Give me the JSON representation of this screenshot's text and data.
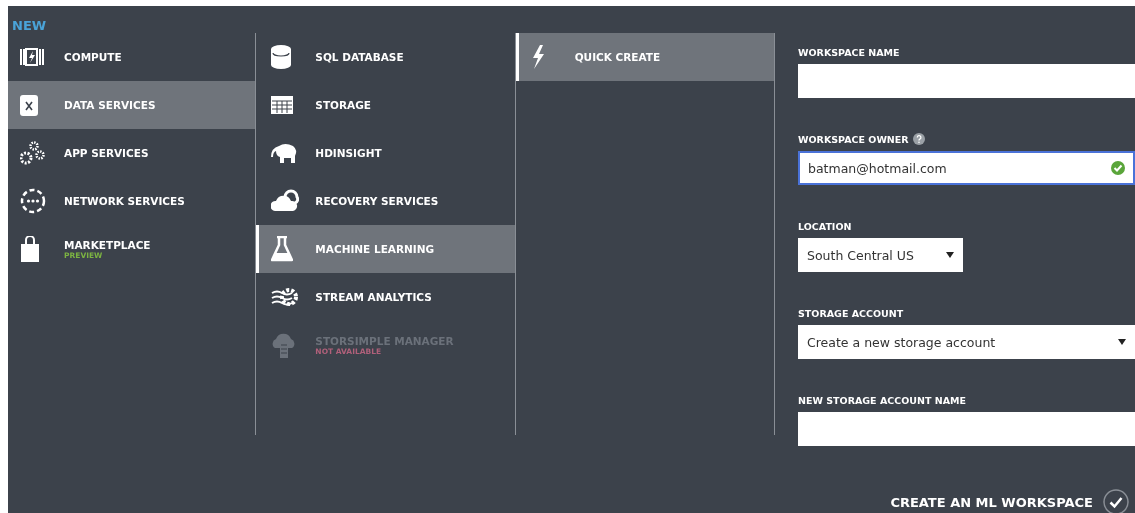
{
  "header": {
    "title": "NEW"
  },
  "categories": [
    {
      "label": "COMPUTE",
      "selected": false
    },
    {
      "label": "DATA SERVICES",
      "selected": true
    },
    {
      "label": "APP SERVICES",
      "selected": false
    },
    {
      "label": "NETWORK SERVICES",
      "selected": false
    },
    {
      "label": "MARKETPLACE",
      "selected": false,
      "sublabel": "PREVIEW"
    }
  ],
  "services": [
    {
      "label": "SQL DATABASE",
      "selected": false,
      "disabled": false
    },
    {
      "label": "STORAGE",
      "selected": false,
      "disabled": false
    },
    {
      "label": "HDINSIGHT",
      "selected": false,
      "disabled": false
    },
    {
      "label": "RECOVERY SERVICES",
      "selected": false,
      "disabled": false
    },
    {
      "label": "MACHINE LEARNING",
      "selected": true,
      "disabled": false
    },
    {
      "label": "STREAM ANALYTICS",
      "selected": false,
      "disabled": false
    },
    {
      "label": "STORSIMPLE MANAGER",
      "selected": false,
      "disabled": true,
      "sublabel": "NOT AVAILABLE"
    }
  ],
  "methods": [
    {
      "label": "QUICK CREATE",
      "selected": true
    }
  ],
  "form": {
    "fields": [
      {
        "kind": "text",
        "label": "WORKSPACE NAME",
        "focused": false,
        "valid": false
      },
      {
        "kind": "text",
        "label": "WORKSPACE OWNER",
        "help": true,
        "value": "batman@hotmail.com",
        "focused": true,
        "valid": true
      },
      {
        "kind": "select",
        "label": "LOCATION",
        "value": "South Central US",
        "focused": false
      },
      {
        "kind": "select",
        "label": "STORAGE ACCOUNT",
        "value": "Create a new storage account",
        "focused": false
      },
      {
        "kind": "text",
        "label": "NEW STORAGE ACCOUNT NAME",
        "focused": false,
        "valid": false
      }
    ],
    "submit": {
      "label": "CREATE AN ML WORKSPACE"
    }
  }
}
